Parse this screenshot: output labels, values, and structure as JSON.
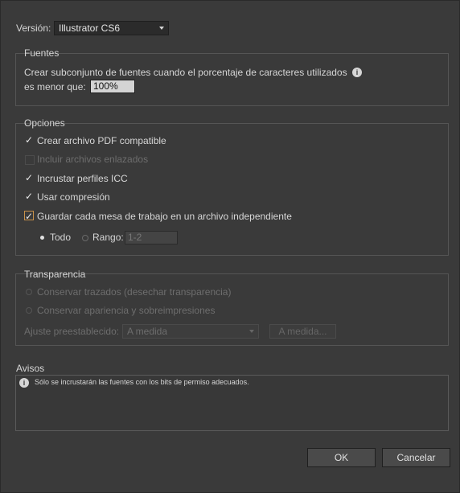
{
  "version": {
    "label": "Versión:",
    "selected": "Illustrator CS6"
  },
  "fuentes": {
    "title": "Fuentes",
    "line1": "Crear subconjunto de fuentes cuando el porcentaje de caracteres utilizados",
    "line2": "es menor que:",
    "value": "100%"
  },
  "opciones": {
    "title": "Opciones",
    "items": [
      {
        "label": "Crear archivo PDF compatible",
        "checked": true,
        "enabled": true
      },
      {
        "label": "Incluir archivos enlazados",
        "checked": false,
        "enabled": false
      },
      {
        "label": "Incrustar perfiles ICC",
        "checked": true,
        "enabled": true
      },
      {
        "label": "Usar compresión",
        "checked": true,
        "enabled": true
      },
      {
        "label": "Guardar cada mesa de trabajo en un archivo independiente",
        "checked": true,
        "enabled": true
      }
    ],
    "todo_label": "Todo",
    "rango_label": "Rango:",
    "rango_value": "1-2"
  },
  "transparencia": {
    "title": "Transparencia",
    "option1": "Conservar trazados (desechar transparencia)",
    "option2": "Conservar apariencia y sobreimpresiones",
    "preset_label": "Ajuste preestablecido:",
    "preset_value": "A medida",
    "custom_button": "A medida..."
  },
  "avisos": {
    "title": "Avisos",
    "message": "Sólo se incrustarán las fuentes con los bits de permiso adecuados."
  },
  "buttons": {
    "ok": "OK",
    "cancel": "Cancelar"
  },
  "icons": {
    "check": "✓",
    "info": "i"
  }
}
